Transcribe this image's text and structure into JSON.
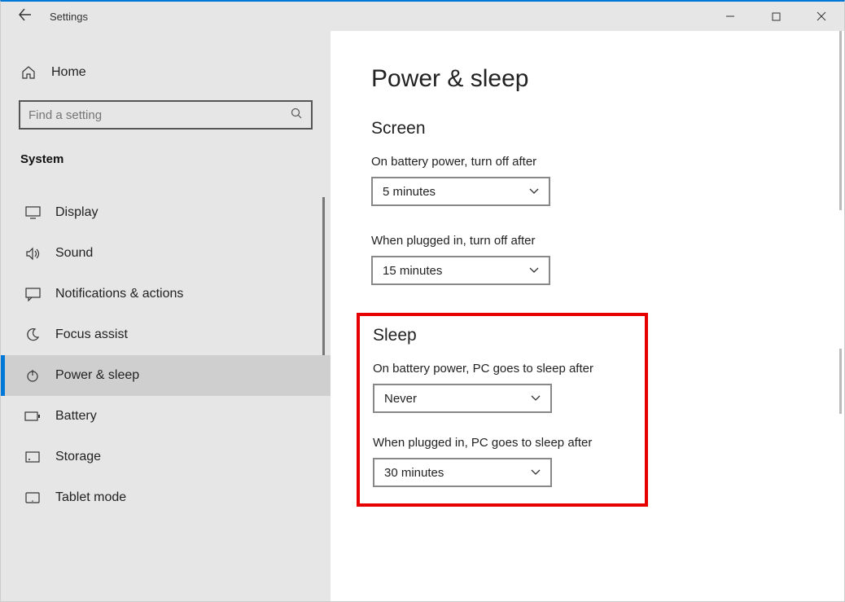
{
  "titlebar": {
    "app_name": "Settings"
  },
  "sidebar": {
    "home_label": "Home",
    "search_placeholder": "Find a setting",
    "group_label": "System",
    "items": [
      {
        "id": "display",
        "label": "Display",
        "icon": "monitor-icon"
      },
      {
        "id": "sound",
        "label": "Sound",
        "icon": "sound-icon"
      },
      {
        "id": "notifications",
        "label": "Notifications & actions",
        "icon": "chat-icon"
      },
      {
        "id": "focus",
        "label": "Focus assist",
        "icon": "moon-icon"
      },
      {
        "id": "power",
        "label": "Power & sleep",
        "icon": "power-icon",
        "selected": true
      },
      {
        "id": "battery",
        "label": "Battery",
        "icon": "battery-icon"
      },
      {
        "id": "storage",
        "label": "Storage",
        "icon": "storage-icon"
      },
      {
        "id": "tablet",
        "label": "Tablet mode",
        "icon": "tablet-icon"
      }
    ]
  },
  "main": {
    "title": "Power & sleep",
    "screen_heading": "Screen",
    "screen_battery_label": "On battery power, turn off after",
    "screen_battery_value": "5 minutes",
    "screen_plugged_label": "When plugged in, turn off after",
    "screen_plugged_value": "15 minutes",
    "sleep_heading": "Sleep",
    "sleep_battery_label": "On battery power, PC goes to sleep after",
    "sleep_battery_value": "Never",
    "sleep_plugged_label": "When plugged in, PC goes to sleep after",
    "sleep_plugged_value": "30 minutes"
  }
}
